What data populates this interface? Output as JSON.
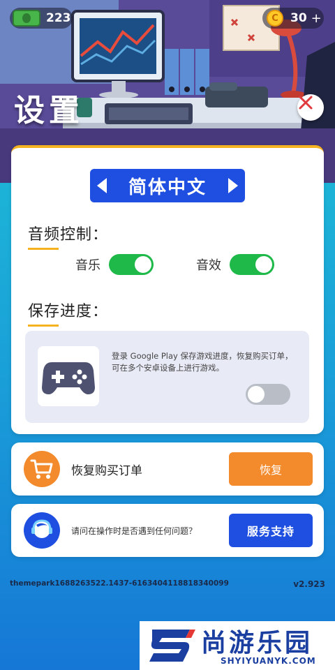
{
  "header": {
    "cash_amount": "223",
    "coin_amount": "30",
    "coin_plus": "+",
    "coin_symbol": "C",
    "title": "设置"
  },
  "language": {
    "label": "简体中文"
  },
  "audio": {
    "heading": "音频控制：",
    "music_label": "音乐",
    "music_on": true,
    "sfx_label": "音效",
    "sfx_on": true
  },
  "save": {
    "heading": "保存进度：",
    "description": "登录 Google Play 保存游戏进度，恢复购买订单，可在多个安卓设备上进行游戏。",
    "google_play_on": false
  },
  "restore": {
    "text": "恢复购买订单",
    "button_label": "恢复"
  },
  "support": {
    "text": "请问在操作时是否遇到任何问题？",
    "button_label": "服务支持"
  },
  "footer": {
    "device_id": "themepark1688263522.1437-6163404118818340099",
    "version": "v2.923"
  },
  "watermark": {
    "title": "尚游乐园",
    "url": "SHYIYUANYK.COM"
  },
  "colors": {
    "accent_blue": "#1f4fe0",
    "accent_orange": "#f38a2b",
    "toggle_green": "#1fb949",
    "underline_yellow": "#f4b220"
  },
  "icons": [
    "cash-icon",
    "coin-icon",
    "close-icon",
    "arrow-left-icon",
    "arrow-right-icon",
    "gamepad-icon",
    "shopping-cart-icon",
    "headset-icon"
  ]
}
